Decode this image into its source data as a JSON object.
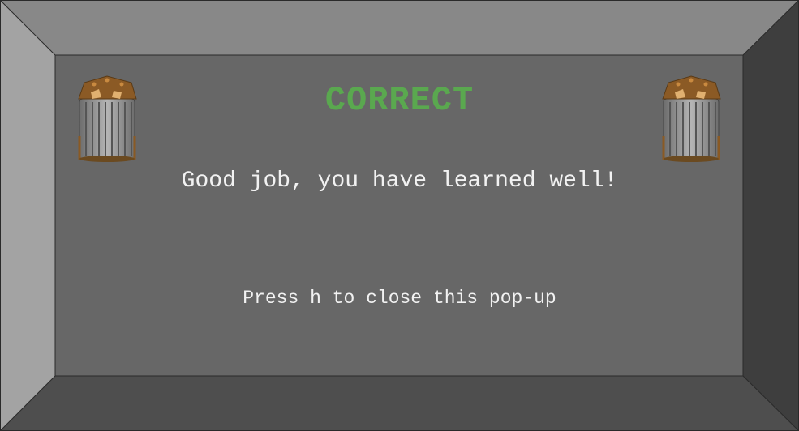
{
  "popup": {
    "title": "CORRECT",
    "message": "Good job, you have learned well!",
    "hint": "Press h to close this pop-up"
  },
  "icons": {
    "left": "trash-bin-icon",
    "right": "trash-bin-icon"
  },
  "colors": {
    "title": "#5aa84f",
    "panel": "#676767",
    "bevel_top": "#888888",
    "bevel_left": "#a3a3a3",
    "bevel_right": "#3e3e3e",
    "bevel_bottom": "#4e4e4e",
    "text": "#f2f2f2"
  }
}
